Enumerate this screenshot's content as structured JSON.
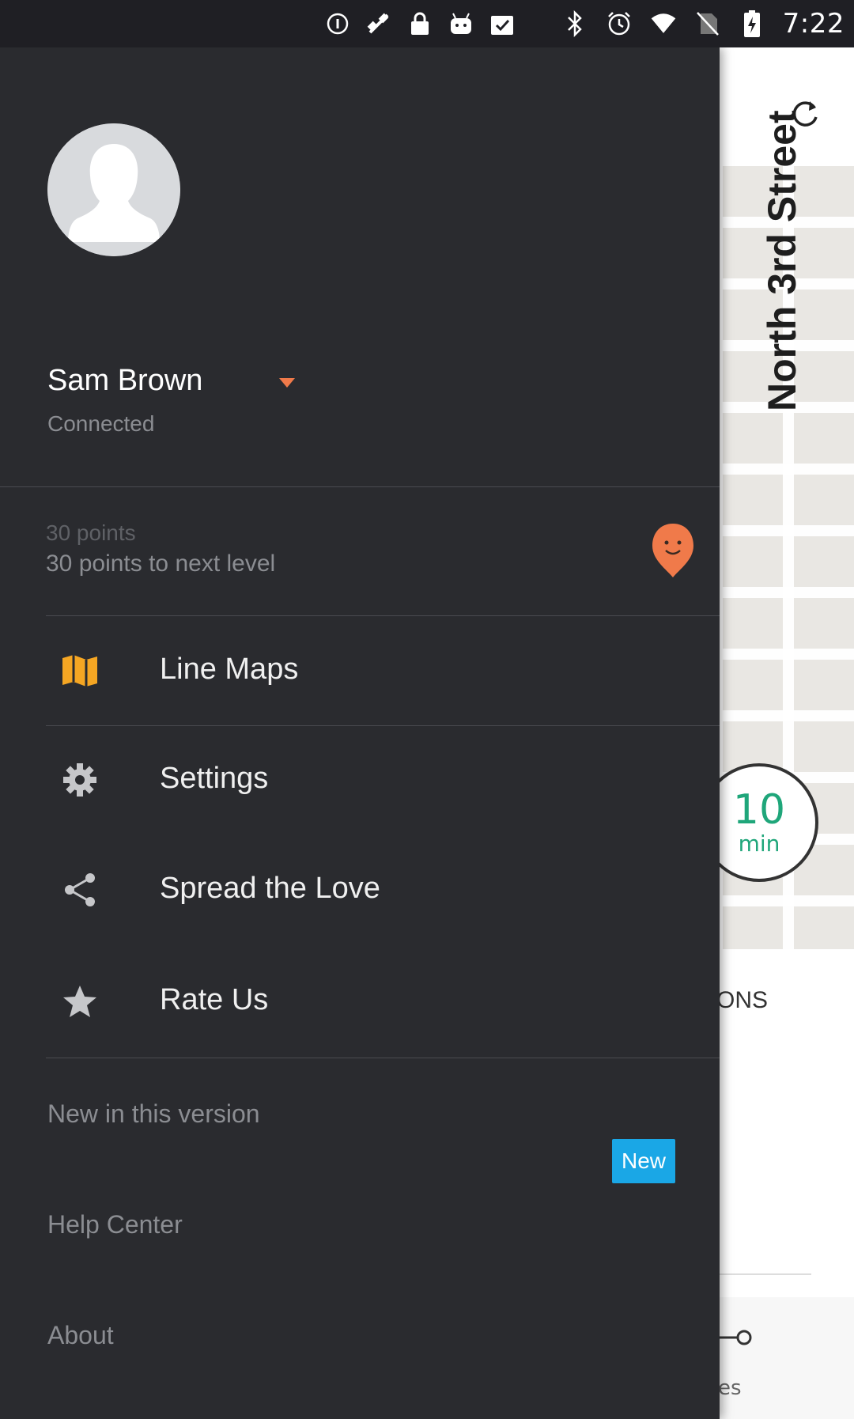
{
  "status_bar": {
    "time": "7:22",
    "left_icons": [
      "info-icon",
      "fake-gps-icon",
      "lock-icon",
      "android-icon",
      "clipboard-check-icon"
    ],
    "right_icons": [
      "bluetooth-icon",
      "alarm-icon",
      "wifi-icon",
      "no-sim-icon",
      "battery-charging-icon"
    ]
  },
  "drawer": {
    "user": {
      "name": "Sam Brown",
      "status": "Connected"
    },
    "points": {
      "value": "30 points",
      "next_level": "30 points to next level"
    },
    "menu": [
      {
        "label": "Line Maps",
        "icon": "map-icon"
      },
      {
        "label": "Settings",
        "icon": "gear-icon"
      },
      {
        "label": "Spread the Love",
        "icon": "share-icon"
      },
      {
        "label": "Rate Us",
        "icon": "star-icon"
      }
    ],
    "secondary": [
      {
        "label": "New in this version",
        "badge": "New"
      },
      {
        "label": "Help Center"
      },
      {
        "label": "About"
      }
    ]
  },
  "background": {
    "street_name": "North 3rd Street",
    "eta": {
      "value": "10",
      "unit": "min"
    },
    "tab_fragment": "ONS",
    "bottom_fragment": "es"
  },
  "colors": {
    "drawer_bg": "#2a2b2f",
    "accent_orange": "#f07a4a",
    "eta_green": "#1fa67a",
    "badge_blue": "#1aa7e6"
  }
}
